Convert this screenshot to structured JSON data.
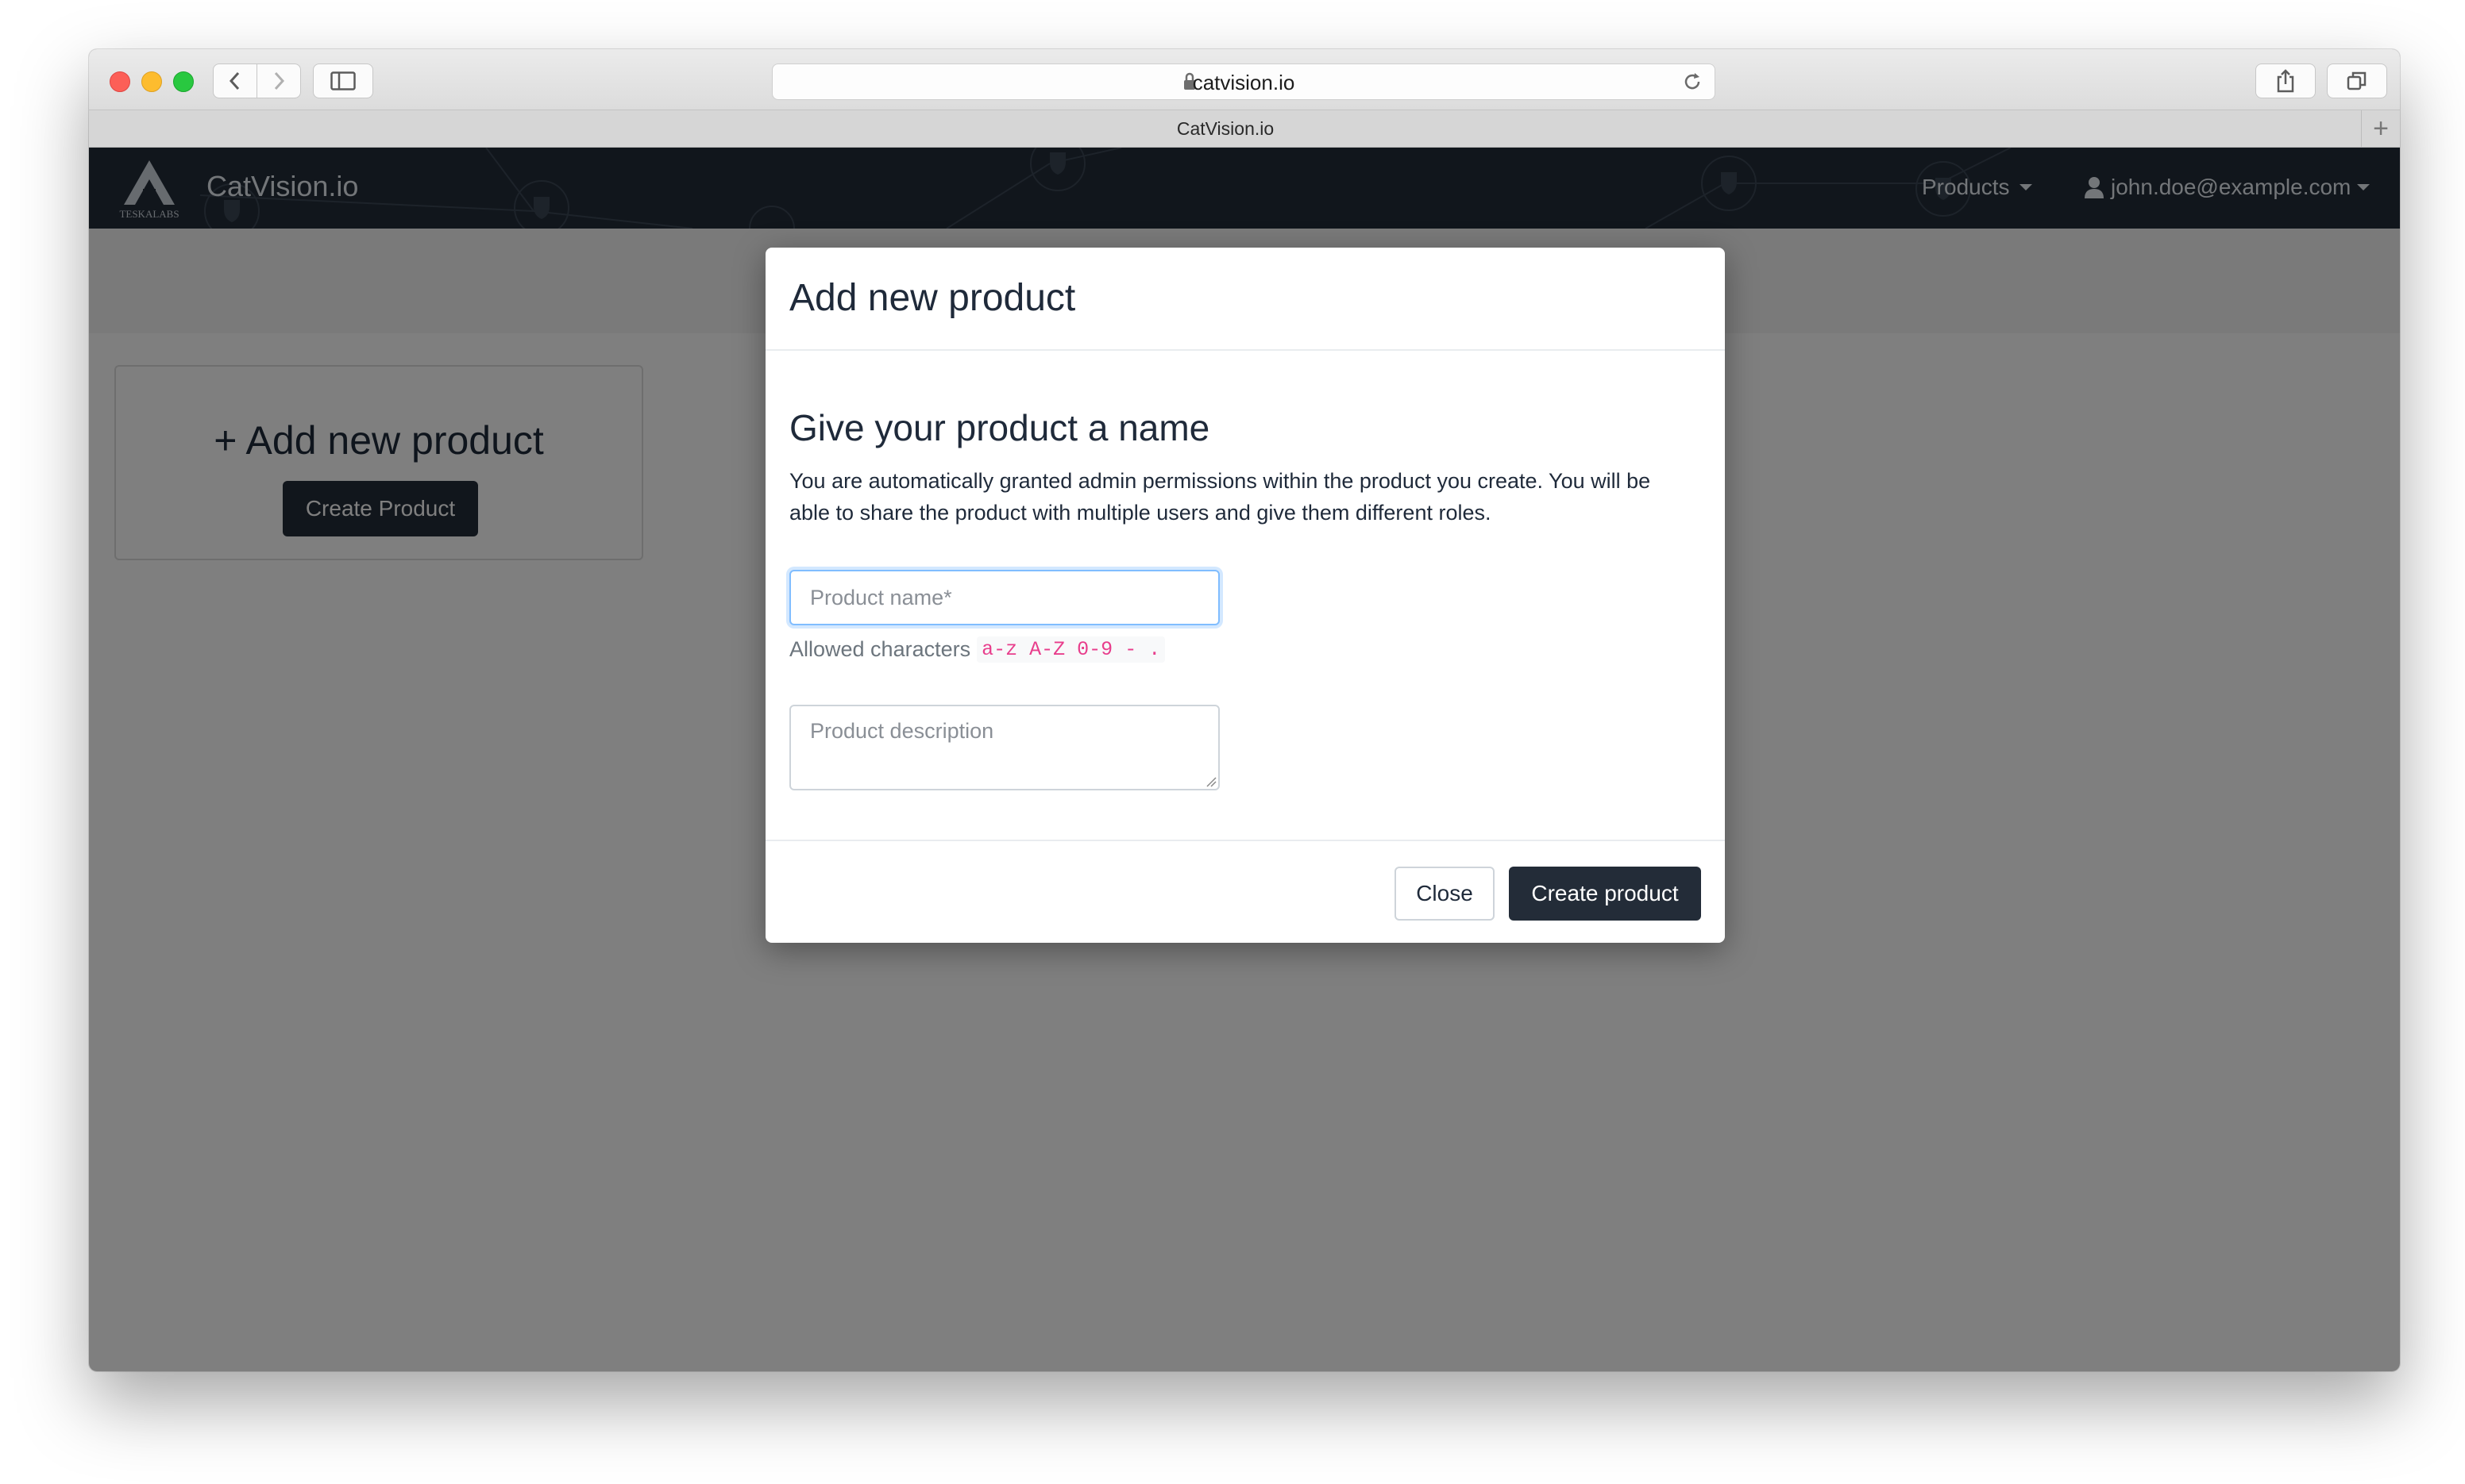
{
  "browser": {
    "url": "catvision.io",
    "tab_title": "CatVision.io"
  },
  "app": {
    "brand_name": "CatVision.io",
    "logo_text": "TESKALABS",
    "nav": {
      "products_label": "Products",
      "user_email": "john.doe@example.com"
    }
  },
  "page": {
    "add_card": {
      "title": "+ Add new product",
      "button_label": "Create Product"
    }
  },
  "modal": {
    "title": "Add new product",
    "section_title": "Give your product a name",
    "description": "You are automatically granted admin permissions within the product you create. You will be able to share the product with multiple users and give them different roles.",
    "name_field": {
      "placeholder": "Product name*",
      "value": ""
    },
    "help_prefix": "Allowed characters",
    "help_codes": [
      "a-z",
      "A-Z",
      "0-9",
      "-",
      "."
    ],
    "description_field": {
      "placeholder": "Product description",
      "value": ""
    },
    "close_label": "Close",
    "create_label": "Create product"
  },
  "colors": {
    "navbar": "#232c38",
    "primary_button": "#232c38",
    "focus_border": "#80bdff",
    "code_text": "#e83e8c"
  }
}
